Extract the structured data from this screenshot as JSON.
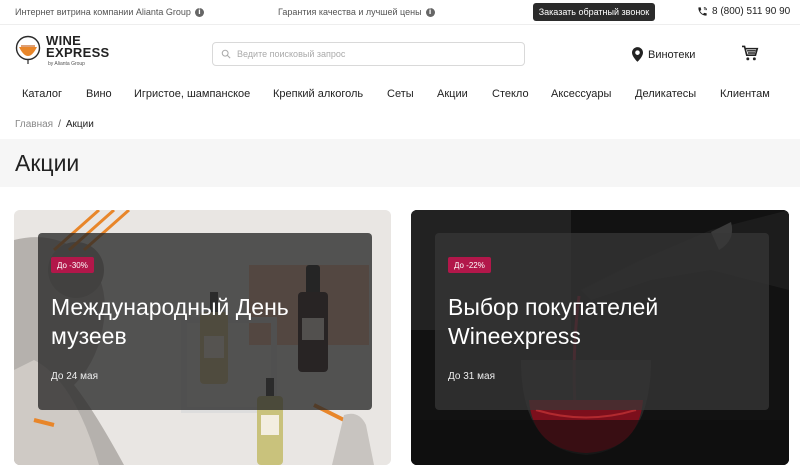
{
  "topbar": {
    "company_note": "Интернет витрина компании Alianta Group",
    "quality_note": "Гарантия качества и лучшей цены",
    "callback_label": "Заказать обратный звонок",
    "phone": "8 (800) 511 90 90"
  },
  "header": {
    "logo_line1": "WINE",
    "logo_line2": "EXPRESS",
    "logo_line3": "by Alianta Group",
    "search_placeholder": "Ведите поисковый запрос",
    "stores_label": "Винотеки"
  },
  "nav": {
    "items": [
      "Каталог",
      "Вино",
      "Игристое, шампанское",
      "Крепкий алкоголь",
      "Сеты",
      "Акции",
      "Стекло",
      "Аксессуары",
      "Деликатесы",
      "Клиентам"
    ]
  },
  "breadcrumb": {
    "home": "Главная",
    "separator": "/",
    "current": "Акции"
  },
  "page": {
    "title": "Акции"
  },
  "promos": [
    {
      "badge": "До -30%",
      "title": "Международный День музеев",
      "date": "До 24 мая"
    },
    {
      "badge": "До -22%",
      "title": "Выбор покупателей Wineexpress",
      "date": "До 31 мая"
    }
  ],
  "colors": {
    "accent": "#b2174a",
    "dark_button": "#2b2b2b",
    "logo_orange": "#e8862a"
  },
  "icons": [
    "info-icon",
    "phone-icon",
    "search-icon",
    "location-pin-icon",
    "cart-icon",
    "wine-glass-logo-icon"
  ]
}
